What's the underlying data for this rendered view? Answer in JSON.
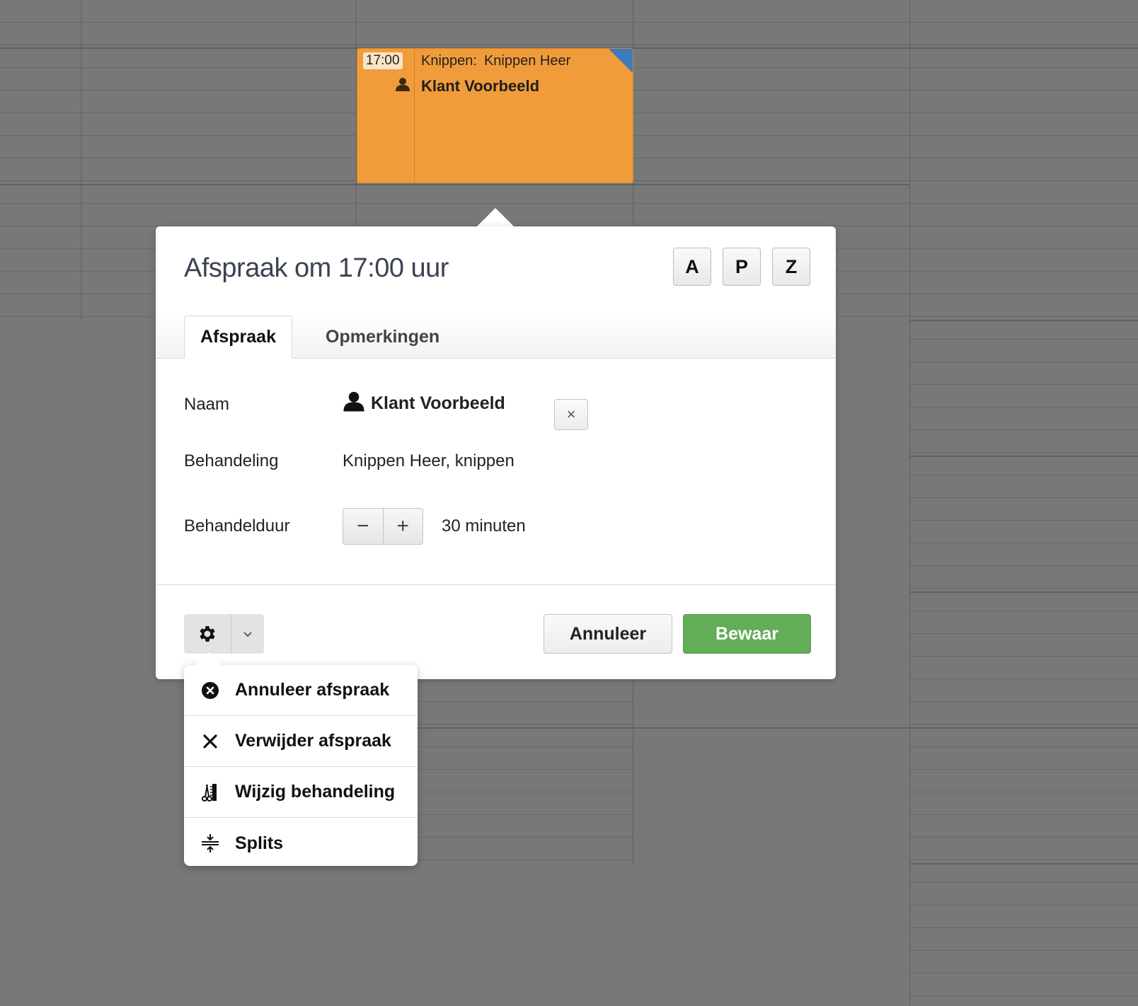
{
  "appointment_block": {
    "time": "17:00",
    "category": "Knippen:",
    "treatment": "Knippen Heer",
    "client": "Klant Voorbeeld",
    "color": "#f19c3a",
    "corner_color": "#3b7bbf"
  },
  "popup": {
    "title": "Afspraak om 17:00 uur",
    "letter_buttons": [
      "A",
      "P",
      "Z"
    ],
    "tabs": [
      {
        "label": "Afspraak",
        "active": true
      },
      {
        "label": "Opmerkingen",
        "active": false
      }
    ],
    "fields": {
      "name_label": "Naam",
      "name_value": "Klant Voorbeeld",
      "treatment_label": "Behandeling",
      "treatment_value": "Knippen Heer, knippen",
      "duration_label": "Behandelduur",
      "duration_value": "30 minuten",
      "clear_symbol": "×",
      "minus_symbol": "−",
      "plus_symbol": "+"
    },
    "footer": {
      "cancel_label": "Annuleer",
      "save_label": "Bewaar",
      "save_color": "#63ac58"
    }
  },
  "actions_menu": {
    "items": [
      {
        "label": "Annuleer afspraak",
        "icon": "cancel-circle-icon"
      },
      {
        "label": "Verwijder afspraak",
        "icon": "close-icon"
      },
      {
        "label": "Wijzig behandeling",
        "icon": "scissors-comb-icon"
      },
      {
        "label": "Splits",
        "icon": "split-icon"
      }
    ]
  }
}
